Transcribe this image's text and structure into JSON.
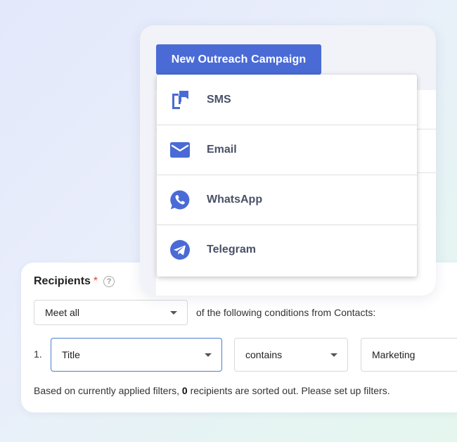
{
  "campaign": {
    "button_label": "New Outreach Campaign",
    "menu_items": [
      {
        "label": "SMS",
        "icon": "sms-icon"
      },
      {
        "label": "Email",
        "icon": "email-icon"
      },
      {
        "label": "WhatsApp",
        "icon": "whatsapp-icon"
      },
      {
        "label": "Telegram",
        "icon": "telegram-icon"
      }
    ]
  },
  "recipients": {
    "title": "Recipients",
    "required_mark": "*",
    "help_glyph": "?",
    "match_select": "Meet all",
    "condition_text": "of the following conditions from Contacts:",
    "rule": {
      "number": "1.",
      "field": "Title",
      "operator": "contains",
      "value": "Marketing"
    },
    "footer": {
      "prefix": "Based on currently applied filters, ",
      "count": "0",
      "suffix": " recipients are sorted out. Please set up filters."
    }
  },
  "colors": {
    "accent": "#4a6bd6",
    "required": "#e8453c",
    "menu_text": "#4a5167",
    "focus_border": "#4a7fd0"
  }
}
